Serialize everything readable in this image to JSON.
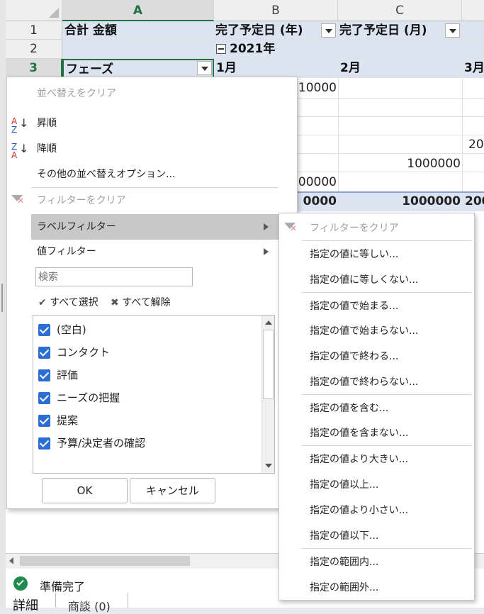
{
  "columns": [
    "A",
    "B",
    "C"
  ],
  "rows": [
    "1",
    "2",
    "3"
  ],
  "cells": {
    "a1": "合計 金額",
    "b1": "完了予定日 (年)",
    "c1": "完了予定日 (月)",
    "b2": "2021年",
    "a3": "フェーズ",
    "b3": "1月",
    "c3": "2月",
    "d3": "3月"
  },
  "values": {
    "v1": "10000",
    "v2": "20",
    "v3": "1000000",
    "v4": "00000",
    "t1": "0000",
    "t2": "1000000",
    "t3": "200"
  },
  "menu": {
    "clear_sort": "並べ替えをクリア",
    "sort_asc": "昇順",
    "sort_desc": "降順",
    "more_sort": "その他の並べ替えオプション...",
    "clear_filter": "フィルターをクリア",
    "label_filter": "ラベルフィルター",
    "value_filter": "値フィルター",
    "search_placeholder": "検索",
    "select_all": "すべて選択",
    "deselect_all": "すべて解除",
    "items": [
      "(空白)",
      "コンタクト",
      "評価",
      "ニーズの把握",
      "提案",
      "予算/決定者の確認"
    ],
    "ok": "OK",
    "cancel": "キャンセル"
  },
  "submenu": {
    "clear_filter": "フィルターをクリア",
    "items": [
      "指定の値に等しい...",
      "指定の値に等しくない...",
      "指定の値で始まる...",
      "指定の値で始まらない...",
      "指定の値で終わる...",
      "指定の値で終わらない...",
      "指定の値を含む...",
      "指定の値を含まない...",
      "指定の値より大きい...",
      "指定の値以上...",
      "指定の値より小さい...",
      "指定の値以下...",
      "指定の範囲内...",
      "指定の範囲外..."
    ]
  },
  "status": {
    "ready": "準備完了",
    "tab_detail": "詳細",
    "tab_deals": "商談 (0)"
  },
  "colors": {
    "accent": "#217346",
    "checkbox": "#2b6fd6",
    "pivot_header": "#dce3f1"
  }
}
